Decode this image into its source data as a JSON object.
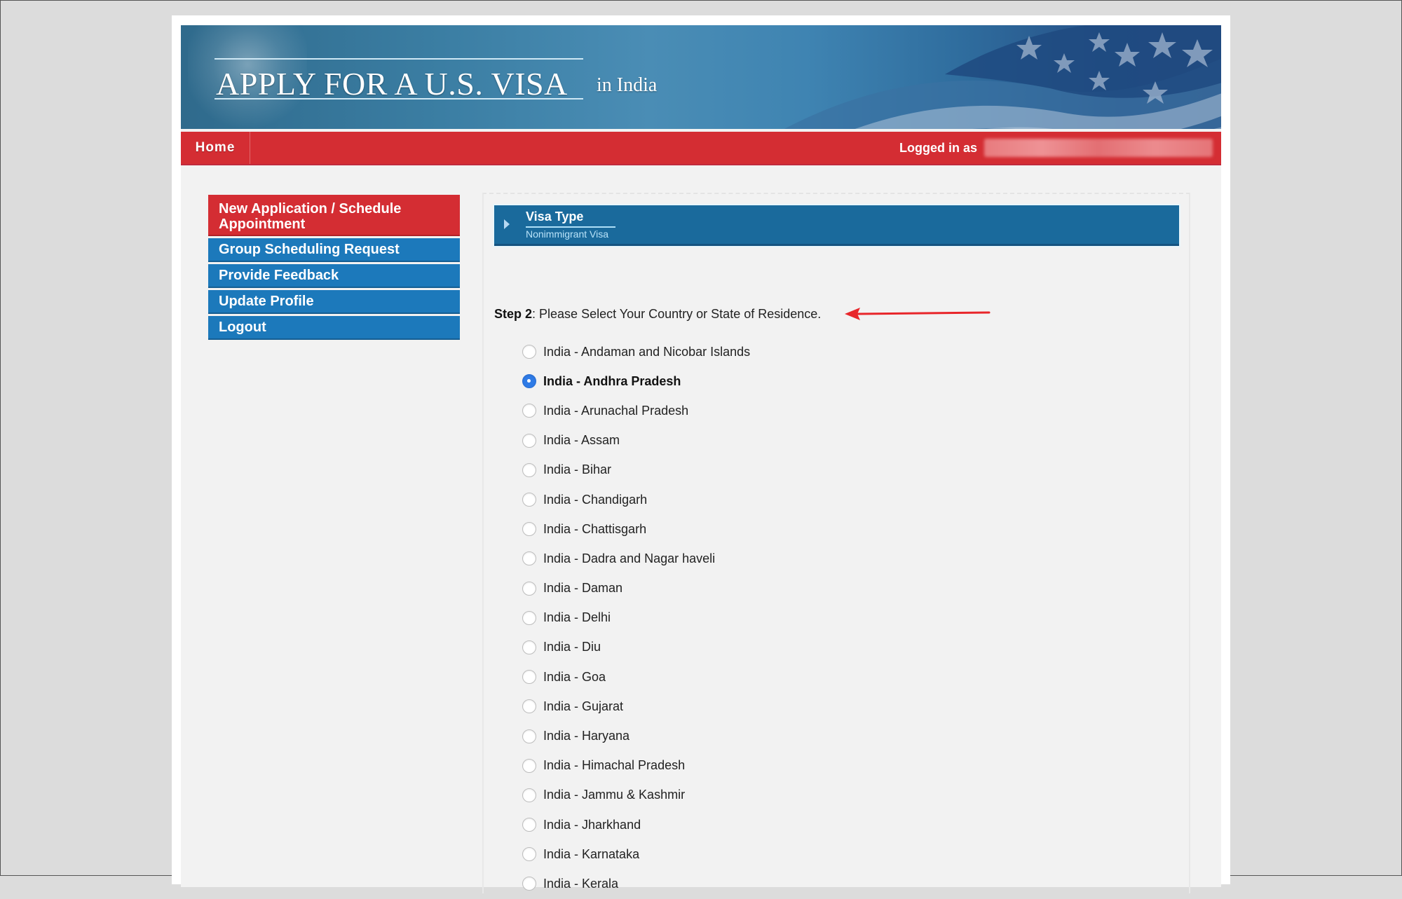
{
  "header": {
    "title": "APPLY FOR A U.S. VISA",
    "location": "in India"
  },
  "navbar": {
    "home_label": "Home",
    "logged_in_label": "Logged in as",
    "user_redacted": true
  },
  "sidebar": {
    "items": [
      {
        "label": "New Application / Schedule Appointment",
        "active": true
      },
      {
        "label": "Group Scheduling Request",
        "active": false
      },
      {
        "label": "Provide Feedback",
        "active": false
      },
      {
        "label": "Update Profile",
        "active": false
      },
      {
        "label": "Logout",
        "active": false
      }
    ]
  },
  "visa_type": {
    "title": "Visa Type",
    "value": "Nonimmigrant Visa"
  },
  "step": {
    "label": "Step 2",
    "text": ": Please Select Your Country or State of Residence."
  },
  "annotation": {
    "arrow_color": "#e8262a",
    "points_to": "step-instruction"
  },
  "residence_options": {
    "selected": "India - Andhra Pradesh",
    "options": [
      "India - Andaman and Nicobar Islands",
      "India - Andhra Pradesh",
      "India - Arunachal Pradesh",
      "India - Assam",
      "India - Bihar",
      "India - Chandigarh",
      "India - Chattisgarh",
      "India - Dadra and Nagar haveli",
      "India - Daman",
      "India - Delhi",
      "India - Diu",
      "India - Goa",
      "India - Gujarat",
      "India - Haryana",
      "India - Himachal Pradesh",
      "India - Jammu & Kashmir",
      "India - Jharkhand",
      "India - Karnataka",
      "India - Kerala"
    ]
  },
  "colors": {
    "nav_red": "#d42d33",
    "sidebar_blue": "#1c79bb",
    "visa_bar_blue": "#1a6a9c",
    "radio_selected": "#2f7be6"
  }
}
